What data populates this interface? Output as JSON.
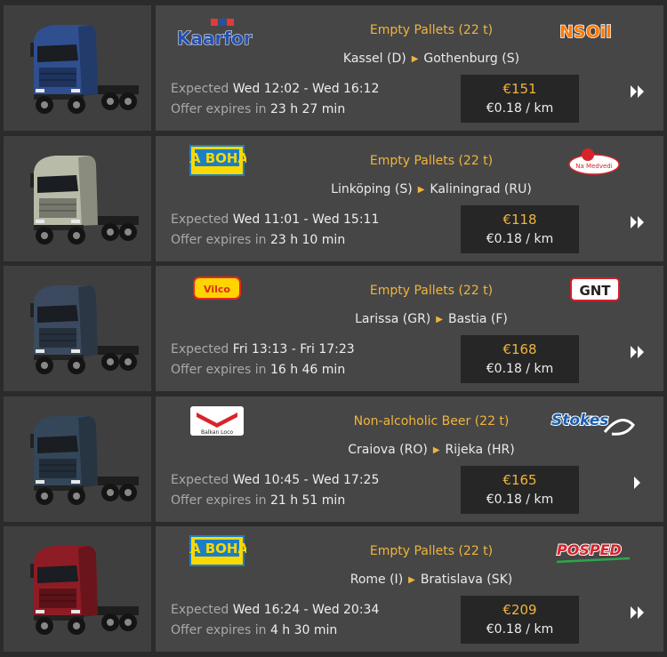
{
  "jobs": [
    {
      "cargo": "Empty Pallets (22 t)",
      "from": "Kassel (D)",
      "to": "Gothenburg (S)",
      "expected_label": "Expected",
      "expected_time": "Wed 12:02 - Wed 16:12",
      "expires_label": "Offer expires in",
      "expires_time": "23 h 27 min",
      "price": "€151",
      "per_km": "€0.18 / km",
      "source_company": "Kaarfor",
      "target_company": "NSOil",
      "truck_color": "#2f4f8f",
      "go_icon": "double-chevron-icon"
    },
    {
      "cargo": "Empty Pallets (22 t)",
      "from": "Linköping (S)",
      "to": "Kaliningrad (RU)",
      "expected_label": "Expected",
      "expected_time": "Wed 11:01 - Wed 15:11",
      "expires_label": "Offer expires in",
      "expires_time": "23 h 10 min",
      "price": "€118",
      "per_km": "€0.18 / km",
      "source_company": "IKA BOHAG",
      "target_company": "Na Medvedi",
      "truck_color": "#b9bba9",
      "go_icon": "double-chevron-icon"
    },
    {
      "cargo": "Empty Pallets (22 t)",
      "from": "Larissa (GR)",
      "to": "Bastia (F)",
      "expected_label": "Expected",
      "expected_time": "Fri 13:13 - Fri 17:23",
      "expires_label": "Offer expires in",
      "expires_time": "16 h 46 min",
      "price": "€168",
      "per_km": "€0.18 / km",
      "source_company": "Vilco",
      "target_company": "GNT",
      "truck_color": "#3b4a5e",
      "go_icon": "double-chevron-icon"
    },
    {
      "cargo": "Non-alcoholic Beer (22 t)",
      "from": "Craiova (RO)",
      "to": "Rijeka (HR)",
      "expected_label": "Expected",
      "expected_time": "Wed 10:45 - Wed 17:25",
      "expires_label": "Offer expires in",
      "expires_time": "21 h 51 min",
      "price": "€165",
      "per_km": "€0.18 / km",
      "source_company": "Balkan Loco",
      "target_company": "Stokes",
      "truck_color": "#34475a",
      "go_icon": "single-chevron-icon"
    },
    {
      "cargo": "Empty Pallets (22 t)",
      "from": "Rome (I)",
      "to": "Bratislava (SK)",
      "expected_label": "Expected",
      "expected_time": "Wed 16:24 - Wed 20:34",
      "expires_label": "Offer expires in",
      "expires_time": "4 h 30 min",
      "price": "€209",
      "per_km": "€0.18 / km",
      "source_company": "IKA BOHAG",
      "target_company": "POSPED",
      "truck_color": "#8e1c25",
      "go_icon": "double-chevron-icon"
    }
  ]
}
